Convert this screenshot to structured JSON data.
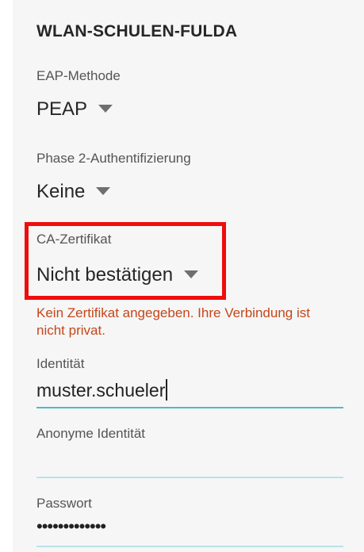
{
  "dialog": {
    "title": "WLAN-SCHULEN-FULDA"
  },
  "eap_method": {
    "label": "EAP-Methode",
    "value": "PEAP"
  },
  "phase2": {
    "label": "Phase 2-Authentifizierung",
    "value": "Keine"
  },
  "ca_cert": {
    "label": "CA-Zertifikat",
    "value": "Nicht bestätigen",
    "warning": "Kein Zertifikat angegeben. Ihre Verbindung ist nicht privat."
  },
  "identity": {
    "label": "Identität",
    "value": "muster.schueler"
  },
  "anonymous_identity": {
    "label": "Anonyme Identität",
    "value": ""
  },
  "password": {
    "label": "Passwort",
    "masked_value": "•••••••••••••"
  },
  "colors": {
    "highlight": "#ef0d0d",
    "error": "#c4471a",
    "accent": "#52b8c8"
  },
  "icons": {
    "dropdown": "caret-down-icon"
  }
}
